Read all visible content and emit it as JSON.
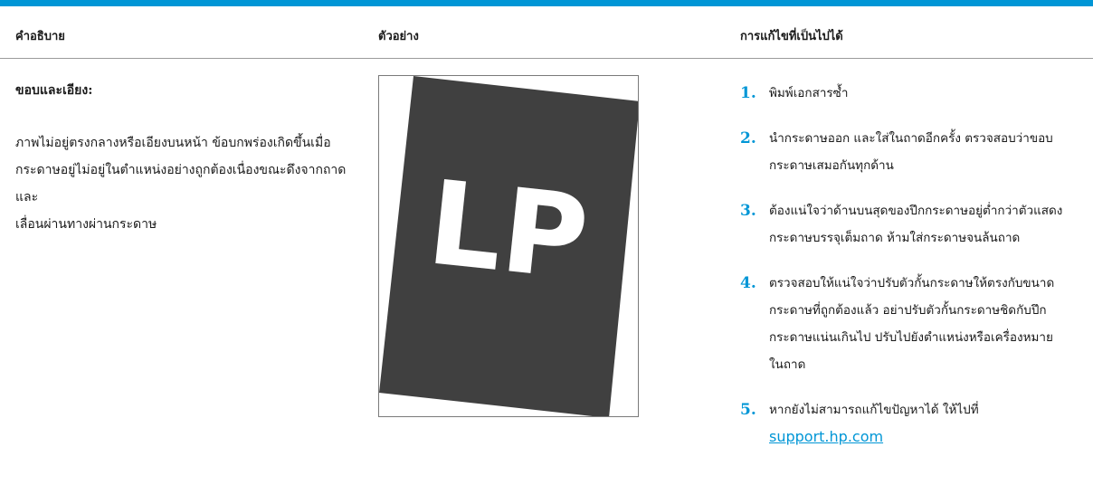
{
  "header": {
    "col1": "คำอธิบาย",
    "col2": "ตัวอย่าง",
    "col3": "การแก้ไขที่เป็นไปได้"
  },
  "description": {
    "title": "ขอบและเอียง:",
    "lines": [
      "ภาพไม่อยู่ตรงกลางหรือเอียงบนหน้า ข้อบกพร่องเกิดขึ้นเมื่อ",
      "กระดาษอยู่ไม่อยู่ในตำแหน่งอย่างถูกต้องเนื่องขณะดึงจากถาด และ",
      "เลื่อนผ่านทางผ่านกระดาษ"
    ]
  },
  "sample": {
    "text": "LP",
    "page_color": "#404040",
    "text_color": "#ffffff"
  },
  "steps": [
    {
      "num": "1.",
      "lines": [
        "พิมพ์เอกสารซ้ำ"
      ]
    },
    {
      "num": "2.",
      "lines": [
        "นำกระดาษออก และใส่ในถาดอีกครั้ง ตรวจสอบว่าขอบ",
        "กระดาษเสมอกันทุกด้าน"
      ]
    },
    {
      "num": "3.",
      "lines": [
        "ต้องแน่ใจว่าด้านบนสุดของปึกกระดาษอยู่ต่ำกว่าตัวแสดง",
        "กระดาษบรรจุเต็มถาด ห้ามใส่กระดาษจนล้นถาด"
      ]
    },
    {
      "num": "4.",
      "lines": [
        "ตรวจสอบให้แน่ใจว่าปรับตัวกั้นกระดาษให้ตรงกับขนาด",
        "กระดาษที่ถูกต้องแล้ว อย่าปรับตัวกั้นกระดาษชิดกับปึก",
        "กระดาษแน่นเกินไป ปรับไปยังตำแหน่งหรือเครื่องหมาย",
        "ในถาด"
      ]
    },
    {
      "num": "5.",
      "lines": [
        "หากยังไม่สามารถแก้ไขปัญหาได้ ให้ไปที่"
      ],
      "link": "support.hp.com"
    }
  ],
  "colors": {
    "accent": "#0096d6",
    "rule": "#9a9a9a"
  }
}
